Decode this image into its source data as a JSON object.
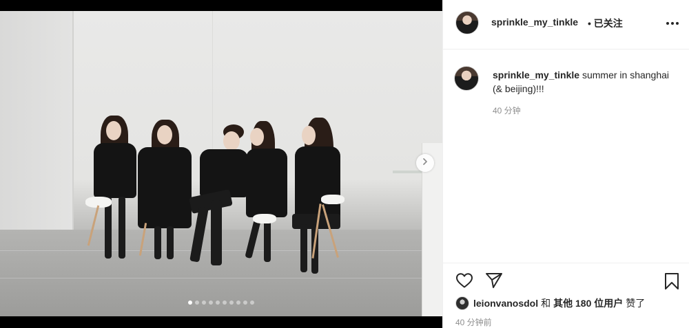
{
  "post": {
    "username": "sprinkle_my_tinkle",
    "follow_status": "• 已关注",
    "caption_user": "sprinkle_my_tinkle",
    "caption_text": "summer in shanghai (& beijing)!!!",
    "caption_time": "40 分钟",
    "likes_user": "leionvanosdol",
    "likes_and": "和",
    "likes_others": "其他 180 位用户",
    "likes_suffix": "赞了",
    "post_time": "40 分钟前"
  },
  "carousel": {
    "dot_count": 10,
    "active_index": 0
  },
  "icons": {
    "like": "heart-outline-icon",
    "share": "paper-plane-icon",
    "save": "bookmark-icon",
    "more": "ellipsis-icon",
    "next": "chevron-right-icon"
  }
}
